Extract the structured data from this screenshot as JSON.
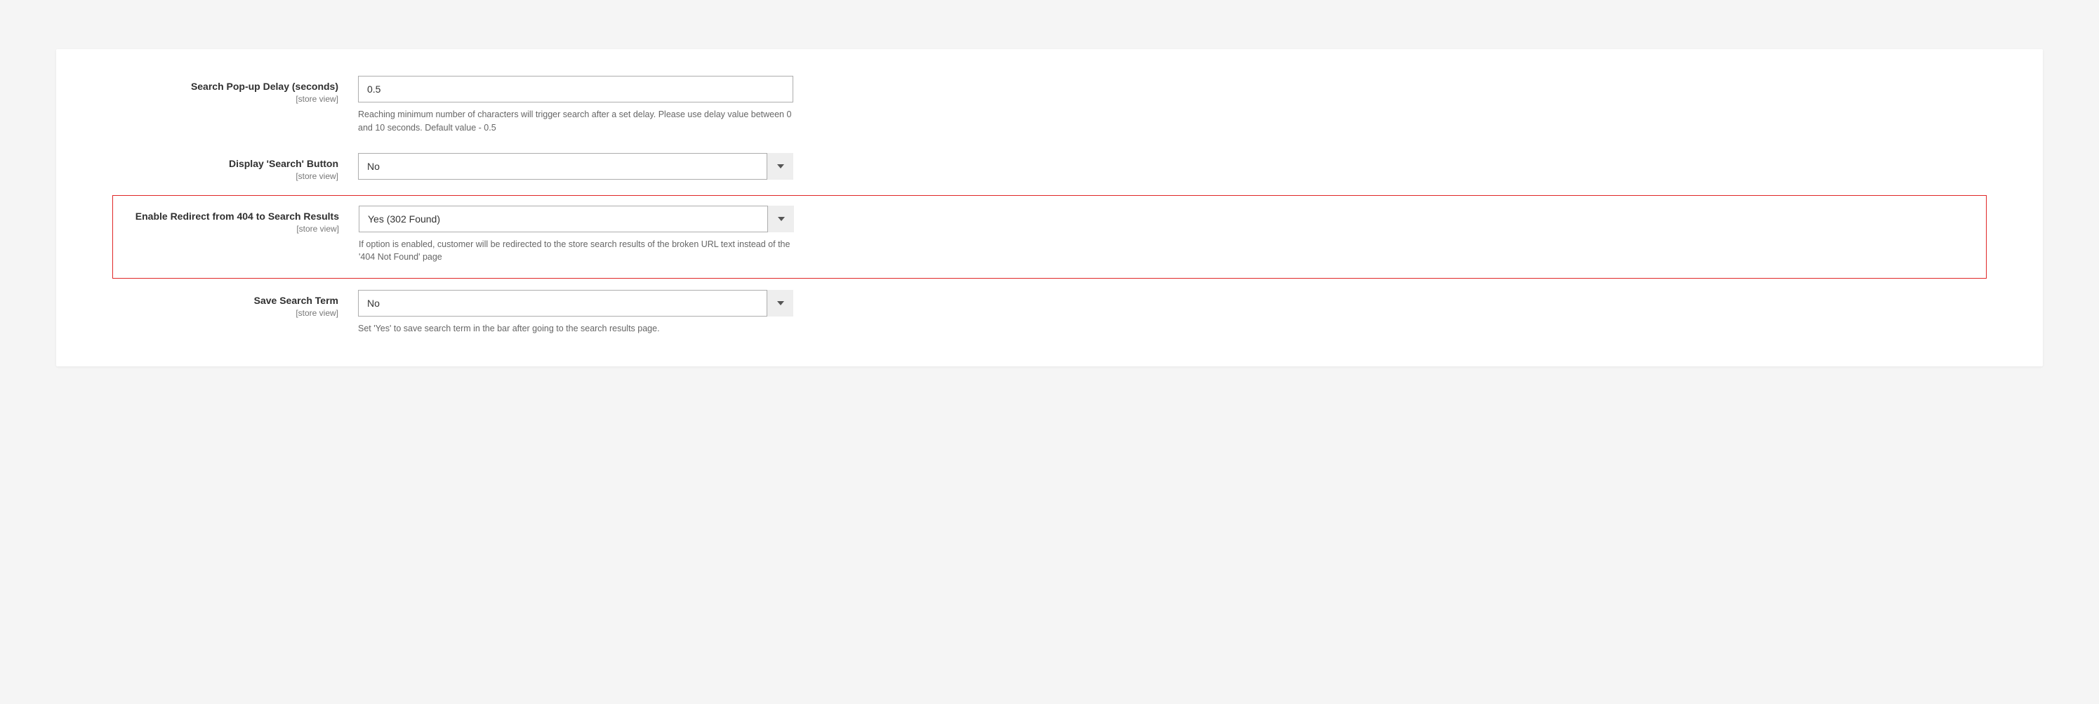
{
  "scope_label": "[store view]",
  "fields": {
    "popup_delay": {
      "label": "Search Pop-up Delay (seconds)",
      "value": "0.5",
      "help": "Reaching minimum number of characters will trigger search after a set delay. Please use delay value between 0 and 10 seconds. Default value - 0.5"
    },
    "display_search_button": {
      "label": "Display 'Search' Button",
      "value": "No"
    },
    "redirect_404": {
      "label": "Enable Redirect from 404 to Search Results",
      "value": "Yes (302 Found)",
      "help": "If option is enabled, customer will be redirected to the store search results of the broken URL text instead of the '404 Not Found' page"
    },
    "save_search_term": {
      "label": "Save Search Term",
      "value": "No",
      "help": "Set 'Yes' to save search term in the bar after going to the search results page."
    }
  }
}
